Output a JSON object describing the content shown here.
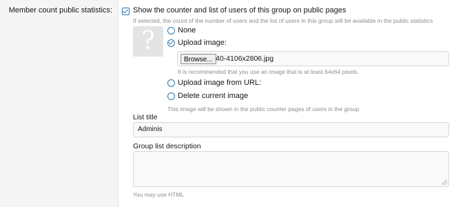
{
  "row": {
    "label": "Member count public statistics:"
  },
  "public_stats": {
    "checked": true,
    "label": "Show the counter and list of users of this group on public pages",
    "hint": "If selected, the count of the number of users and the list of users in this group will be available in the public statistics"
  },
  "image": {
    "placeholder_glyph": "?",
    "options": [
      {
        "label": "None",
        "selected": false
      },
      {
        "label": "Upload image:",
        "selected": true
      },
      {
        "label": "Upload image from URL:",
        "selected": false
      },
      {
        "label": "Delete current image",
        "selected": false
      }
    ],
    "browse_label": "Browse...",
    "file_name": "40-4106x2806.jpg",
    "size_hint": "It is recommended that you use an image that is at least 64x64 pixels.",
    "usage_hint": "This image will be shown in the public counter pages of users in the group"
  },
  "list_title": {
    "label": "List title",
    "value": "Adminis"
  },
  "group_list_description": {
    "label": "Group list description",
    "value": "",
    "hint": "You may use HTML"
  },
  "colors": {
    "accent": "#2577b1",
    "hint_text": "#8c8c8c",
    "label_panel": "#f5f5f5"
  }
}
